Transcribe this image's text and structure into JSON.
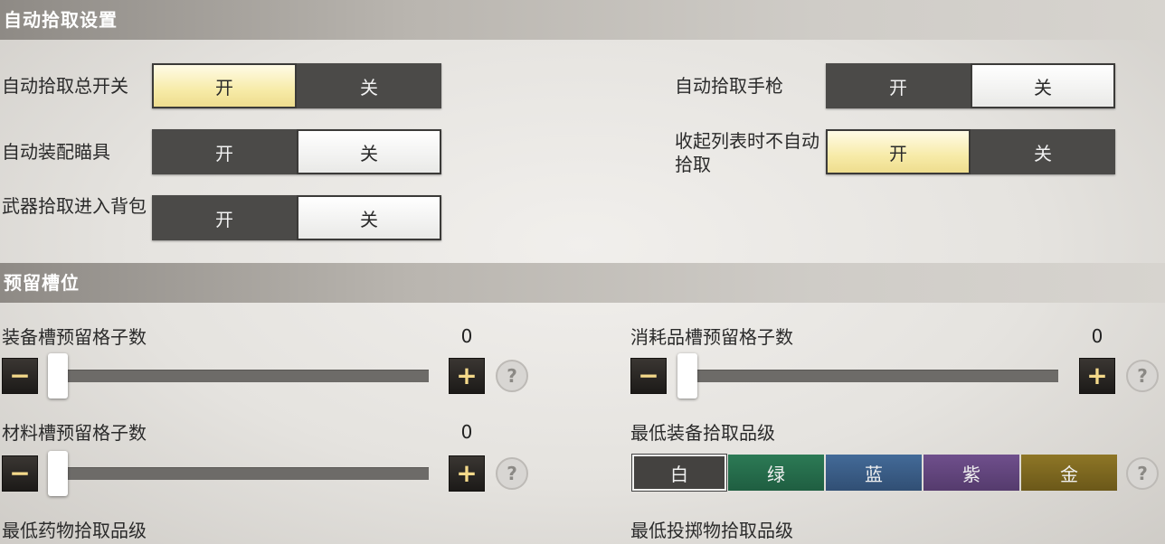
{
  "sections": {
    "auto_pickup": {
      "title": "自动拾取设置"
    },
    "reserve": {
      "title": "预留槽位"
    }
  },
  "toggles": {
    "master": {
      "label": "自动拾取总开关",
      "on": "开",
      "off": "关",
      "selected": "on"
    },
    "pistol": {
      "label": "自动拾取手枪",
      "on": "开",
      "off": "关",
      "selected": "off"
    },
    "scope": {
      "label": "自动装配瞄具",
      "on": "开",
      "off": "关",
      "selected": "off"
    },
    "collapse": {
      "label": "收起列表时不自动拾取",
      "on": "开",
      "off": "关",
      "selected": "on"
    },
    "weapon": {
      "label": "武器拾取进入背包",
      "on": "开",
      "off": "关",
      "selected": "off"
    }
  },
  "sliders": {
    "equipment": {
      "label": "装备槽预留格子数",
      "value": "0",
      "minus": "−",
      "plus": "+",
      "help": "?"
    },
    "consumable": {
      "label": "消耗品槽预留格子数",
      "value": "0",
      "minus": "−",
      "plus": "+",
      "help": "?"
    },
    "material": {
      "label": "材料槽预留格子数",
      "value": "0",
      "minus": "−",
      "plus": "+",
      "help": "?"
    }
  },
  "quality": {
    "equipment": {
      "label": "最低装备拾取品级",
      "options": [
        "白",
        "绿",
        "蓝",
        "紫",
        "金"
      ],
      "selected": "白",
      "help": "?"
    },
    "medicine": {
      "label": "最低药物拾取品级"
    },
    "throwable": {
      "label": "最低投掷物拾取品级"
    }
  },
  "colors": {
    "selected_gold": "#f7eba8",
    "quality_green": "#2c7a55",
    "quality_blue": "#436a98",
    "quality_purple": "#6f4f8c",
    "quality_gold": "#8e7626",
    "button_plus_minus": "#f4d98a"
  }
}
